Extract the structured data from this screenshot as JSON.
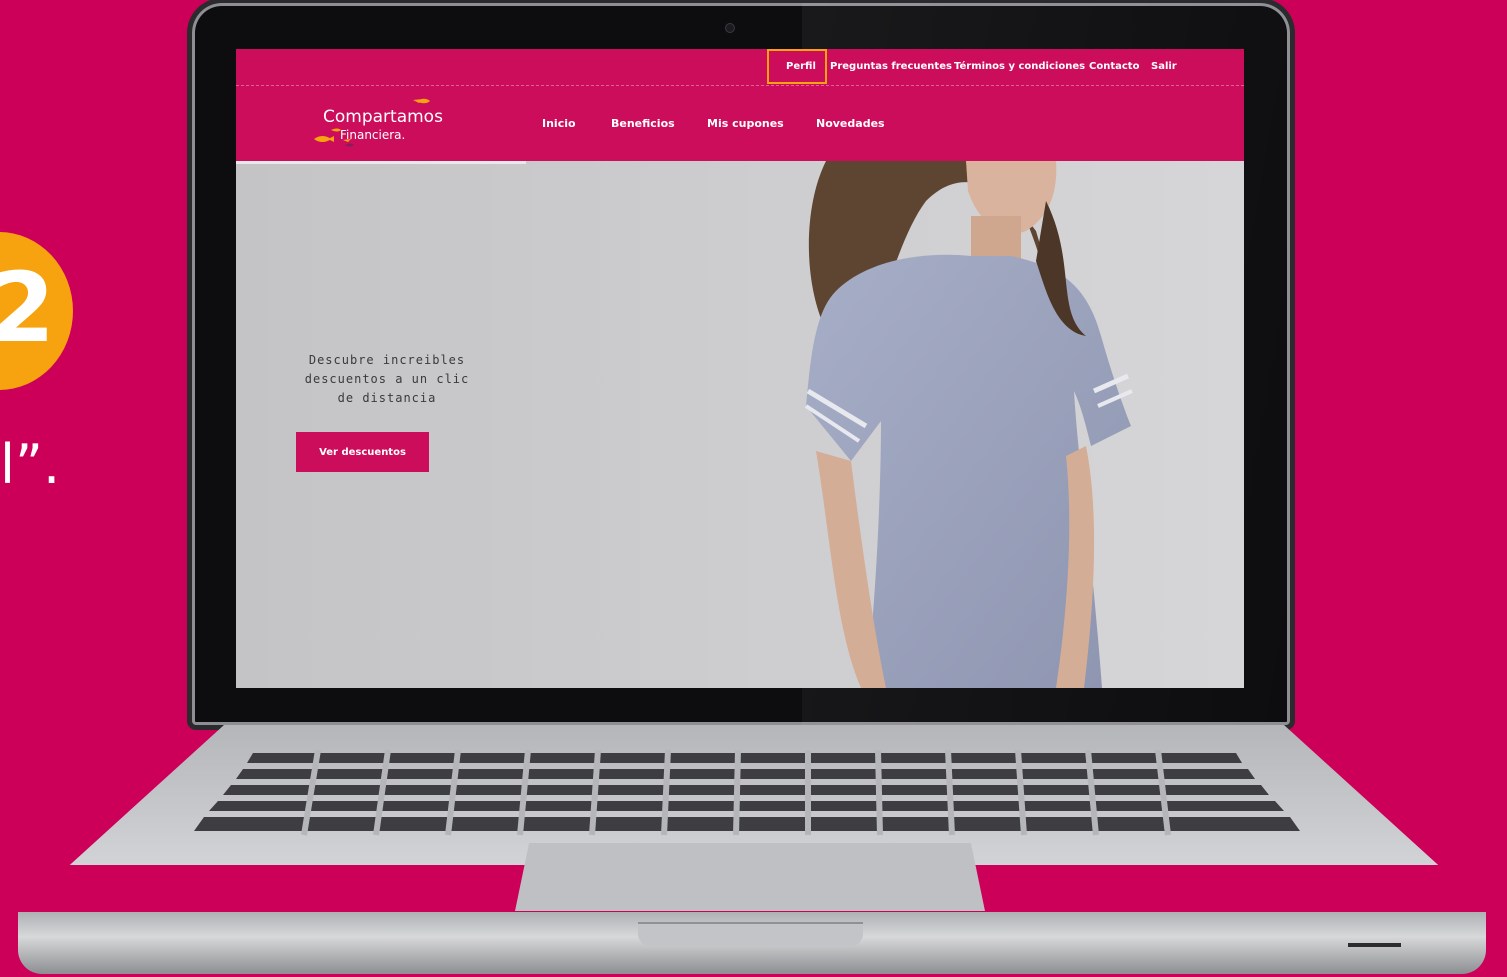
{
  "step": {
    "number": "2",
    "text": "l”."
  },
  "site": {
    "top_links": [
      "Perfil",
      "Preguntas frecuentes",
      "Términos y condiciones",
      "Contacto",
      "Salir"
    ],
    "logo": {
      "name": "Compartamos",
      "subtitle": "Financiera",
      "mark": "."
    },
    "nav": [
      "Inicio",
      "Beneficios",
      "Mis cupones",
      "Novedades"
    ],
    "hero": {
      "line1": "Descubre increibles",
      "line2": "descuentos a un clic de distancia",
      "button": "Ver descuentos"
    },
    "highlighted_item": "Perfil"
  },
  "colors": {
    "background": "#cc0058",
    "brand": "#cc0d5c",
    "highlight": "#f7a20f",
    "badge": "#f7a20f"
  },
  "icons": [
    "logo-fish-icon",
    "webcam-icon"
  ]
}
